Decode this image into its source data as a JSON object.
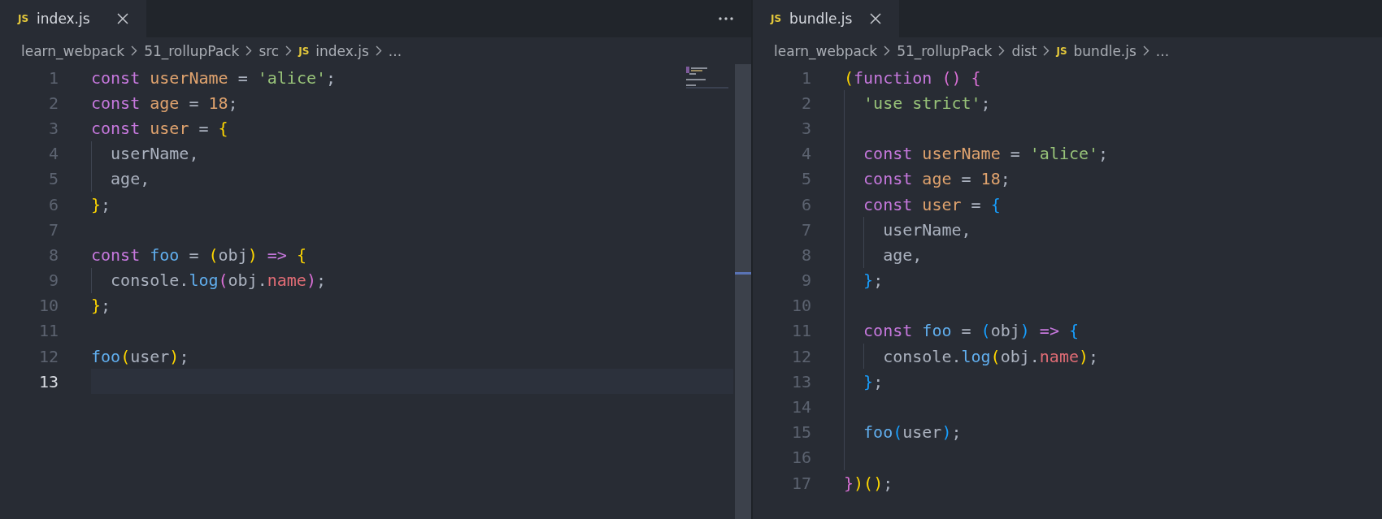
{
  "panes": [
    {
      "tab": {
        "icon_text": "JS",
        "label": "index.js",
        "selected": true
      },
      "more_actions": true,
      "minimap": true,
      "breadcrumbs": [
        {
          "text": "learn_webpack"
        },
        {
          "text": "51_rollupPack"
        },
        {
          "text": "src"
        },
        {
          "icon_text": "JS",
          "text": "index.js"
        },
        {
          "text": "..."
        }
      ],
      "lines": [
        {
          "number": "1",
          "active": false,
          "tokens": [
            {
              "kind": "keyword",
              "text": "const"
            },
            {
              "kind": "variable",
              "text": " userName"
            },
            {
              "kind": "plain",
              "text": " = "
            },
            {
              "kind": "string",
              "text": "'alice'"
            },
            {
              "kind": "plain",
              "text": ";"
            }
          ]
        },
        {
          "number": "2",
          "active": false,
          "tokens": [
            {
              "kind": "keyword",
              "text": "const"
            },
            {
              "kind": "variable",
              "text": " age"
            },
            {
              "kind": "plain",
              "text": " = "
            },
            {
              "kind": "number",
              "text": "18"
            },
            {
              "kind": "plain",
              "text": ";"
            }
          ]
        },
        {
          "number": "3",
          "active": false,
          "tokens": [
            {
              "kind": "keyword",
              "text": "const"
            },
            {
              "kind": "variable",
              "text": " user"
            },
            {
              "kind": "plain",
              "text": " = "
            },
            {
              "kind": "bracket1",
              "text": "{"
            }
          ],
          "children": [
            {
              "number": "4",
              "active": false,
              "tokens": [
                {
                  "kind": "plain",
                  "text": "userName,"
                }
              ]
            },
            {
              "number": "5",
              "active": false,
              "tokens": [
                {
                  "kind": "plain",
                  "text": "age,"
                }
              ]
            }
          ]
        },
        {
          "number": "6",
          "active": false,
          "tokens": [
            {
              "kind": "bracket1",
              "text": "}"
            },
            {
              "kind": "plain",
              "text": ";"
            }
          ]
        },
        {
          "number": "7",
          "active": false
        },
        {
          "number": "8",
          "active": false,
          "tokens": [
            {
              "kind": "keyword",
              "text": "const"
            },
            {
              "kind": "function",
              "text": " foo"
            },
            {
              "kind": "plain",
              "text": " = "
            },
            {
              "kind": "bracket1",
              "text": "("
            },
            {
              "kind": "plain",
              "text": "obj"
            },
            {
              "kind": "bracket1",
              "text": ")"
            },
            {
              "kind": "arrow",
              "text": " =>"
            },
            {
              "kind": "bracket1",
              "text": " {"
            }
          ],
          "children": [
            {
              "number": "9",
              "active": false,
              "tokens": [
                {
                  "kind": "plain",
                  "text": "console."
                },
                {
                  "kind": "function",
                  "text": "log"
                },
                {
                  "kind": "bracket2",
                  "text": "("
                },
                {
                  "kind": "plain",
                  "text": "obj."
                },
                {
                  "kind": "property",
                  "text": "name"
                },
                {
                  "kind": "bracket2",
                  "text": ")"
                },
                {
                  "kind": "plain",
                  "text": ";"
                }
              ]
            }
          ]
        },
        {
          "number": "10",
          "active": false,
          "tokens": [
            {
              "kind": "bracket1",
              "text": "}"
            },
            {
              "kind": "plain",
              "text": ";"
            }
          ]
        },
        {
          "number": "11",
          "active": false
        },
        {
          "number": "12",
          "active": false,
          "tokens": [
            {
              "kind": "function",
              "text": "foo"
            },
            {
              "kind": "bracket1",
              "text": "("
            },
            {
              "kind": "plain",
              "text": "user"
            },
            {
              "kind": "bracket1",
              "text": ")"
            },
            {
              "kind": "plain",
              "text": ";"
            }
          ]
        },
        {
          "number": "13",
          "active": true
        }
      ]
    },
    {
      "tab": {
        "icon_text": "JS",
        "label": "bundle.js",
        "selected": true
      },
      "more_actions": false,
      "minimap": false,
      "breadcrumbs": [
        {
          "text": "learn_webpack"
        },
        {
          "text": "51_rollupPack"
        },
        {
          "text": "dist"
        },
        {
          "icon_text": "JS",
          "text": "bundle.js"
        },
        {
          "text": "..."
        }
      ],
      "lines": [
        {
          "number": "1",
          "active": false,
          "tokens": [
            {
              "kind": "bracket1",
              "text": "("
            },
            {
              "kind": "keyword",
              "text": "function"
            },
            {
              "kind": "bracket2",
              "text": " ()"
            },
            {
              "kind": "bracket2",
              "text": " {"
            }
          ],
          "children": [
            {
              "number": "2",
              "active": false,
              "tokens": [
                {
                  "kind": "string",
                  "text": "'use strict'"
                },
                {
                  "kind": "plain",
                  "text": ";"
                }
              ]
            },
            {
              "number": "3",
              "active": false
            },
            {
              "number": "4",
              "active": false,
              "tokens": [
                {
                  "kind": "keyword",
                  "text": "const"
                },
                {
                  "kind": "variable",
                  "text": " userName"
                },
                {
                  "kind": "plain",
                  "text": " = "
                },
                {
                  "kind": "string",
                  "text": "'alice'"
                },
                {
                  "kind": "plain",
                  "text": ";"
                }
              ]
            },
            {
              "number": "5",
              "active": false,
              "tokens": [
                {
                  "kind": "keyword",
                  "text": "const"
                },
                {
                  "kind": "variable",
                  "text": " age"
                },
                {
                  "kind": "plain",
                  "text": " = "
                },
                {
                  "kind": "number",
                  "text": "18"
                },
                {
                  "kind": "plain",
                  "text": ";"
                }
              ]
            },
            {
              "number": "6",
              "active": false,
              "tokens": [
                {
                  "kind": "keyword",
                  "text": "const"
                },
                {
                  "kind": "variable",
                  "text": " user"
                },
                {
                  "kind": "plain",
                  "text": " = "
                },
                {
                  "kind": "bracket3",
                  "text": "{"
                }
              ],
              "children": [
                {
                  "number": "7",
                  "active": false,
                  "tokens": [
                    {
                      "kind": "plain",
                      "text": "userName,"
                    }
                  ]
                },
                {
                  "number": "8",
                  "active": false,
                  "tokens": [
                    {
                      "kind": "plain",
                      "text": "age,"
                    }
                  ]
                }
              ]
            },
            {
              "number": "9",
              "active": false,
              "tokens": [
                {
                  "kind": "bracket3",
                  "text": "}"
                },
                {
                  "kind": "plain",
                  "text": ";"
                }
              ]
            },
            {
              "number": "10",
              "active": false
            },
            {
              "number": "11",
              "active": false,
              "tokens": [
                {
                  "kind": "keyword",
                  "text": "const"
                },
                {
                  "kind": "function",
                  "text": " foo"
                },
                {
                  "kind": "plain",
                  "text": " = "
                },
                {
                  "kind": "bracket3",
                  "text": "("
                },
                {
                  "kind": "plain",
                  "text": "obj"
                },
                {
                  "kind": "bracket3",
                  "text": ")"
                },
                {
                  "kind": "arrow",
                  "text": " =>"
                },
                {
                  "kind": "bracket3",
                  "text": " {"
                }
              ],
              "children": [
                {
                  "number": "12",
                  "active": false,
                  "tokens": [
                    {
                      "kind": "plain",
                      "text": "console."
                    },
                    {
                      "kind": "function",
                      "text": "log"
                    },
                    {
                      "kind": "bracket1",
                      "text": "("
                    },
                    {
                      "kind": "plain",
                      "text": "obj."
                    },
                    {
                      "kind": "property",
                      "text": "name"
                    },
                    {
                      "kind": "bracket1",
                      "text": ")"
                    },
                    {
                      "kind": "plain",
                      "text": ";"
                    }
                  ]
                }
              ]
            },
            {
              "number": "13",
              "active": false,
              "tokens": [
                {
                  "kind": "bracket3",
                  "text": "}"
                },
                {
                  "kind": "plain",
                  "text": ";"
                }
              ]
            },
            {
              "number": "14",
              "active": false
            },
            {
              "number": "15",
              "active": false,
              "tokens": [
                {
                  "kind": "function",
                  "text": "foo"
                },
                {
                  "kind": "bracket3",
                  "text": "("
                },
                {
                  "kind": "plain",
                  "text": "user"
                },
                {
                  "kind": "bracket3",
                  "text": ")"
                },
                {
                  "kind": "plain",
                  "text": ";"
                }
              ]
            },
            {
              "number": "16",
              "active": false
            }
          ]
        },
        {
          "number": "17",
          "active": false,
          "tokens": [
            {
              "kind": "bracket2",
              "text": "}"
            },
            {
              "kind": "bracket1",
              "text": ")"
            },
            {
              "kind": "bracket1",
              "text": "()"
            },
            {
              "kind": "plain",
              "text": ";"
            }
          ]
        }
      ]
    }
  ]
}
